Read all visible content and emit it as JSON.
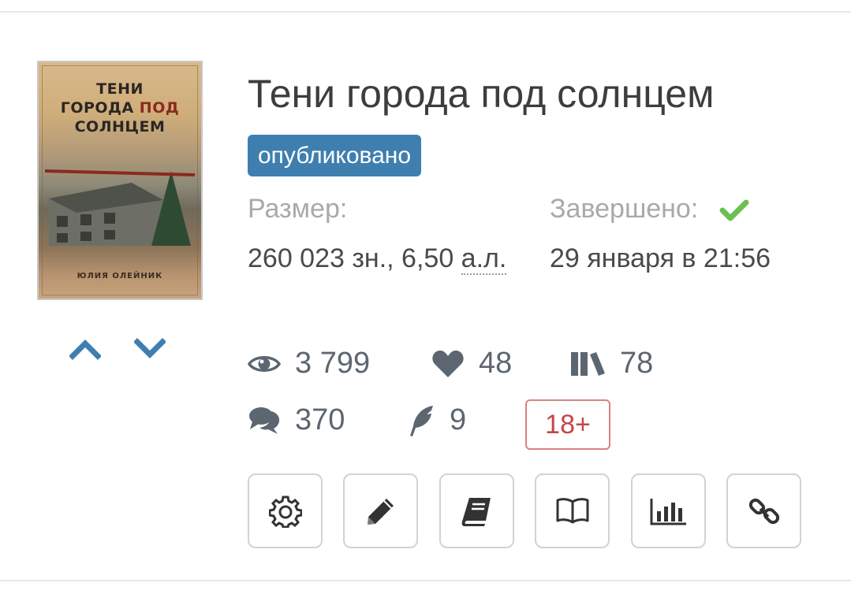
{
  "book": {
    "title": "Тени города под солнцем",
    "status": "опубликовано",
    "cover": {
      "title_line1": "ТЕНИ",
      "title_line2a": "ГОРОДА ",
      "title_line2b": "ПОД",
      "title_line3": "СОЛНЦЕМ",
      "author": "ЮЛИЯ ОЛЕЙНИК"
    },
    "size_label": "Размер:",
    "size_value": "260 023 зн., 6,50 ",
    "size_unit": "а.л.",
    "completed_label": "Завершено:",
    "completed_value": "29 января в 21:56",
    "stats": {
      "views": "3 799",
      "likes": "48",
      "libraries": "78",
      "comments": "370",
      "reviews": "9"
    },
    "age_rating": "18+"
  },
  "icons": {
    "vote_up": "chevron-up-icon",
    "vote_down": "chevron-down-icon",
    "views": "eye-icon",
    "likes": "heart-icon",
    "libraries": "books-icon",
    "comments": "comments-icon",
    "reviews": "feather-icon",
    "completed": "check-icon",
    "actions": [
      "gear-icon",
      "pencil-icon",
      "book-icon",
      "open-book-icon",
      "bar-chart-icon",
      "link-icon"
    ]
  },
  "colors": {
    "accent": "#3f7fb0",
    "check": "#6cbf52",
    "age_border": "#d98282",
    "age_text": "#c64545",
    "stat_icon": "#5c6670"
  }
}
